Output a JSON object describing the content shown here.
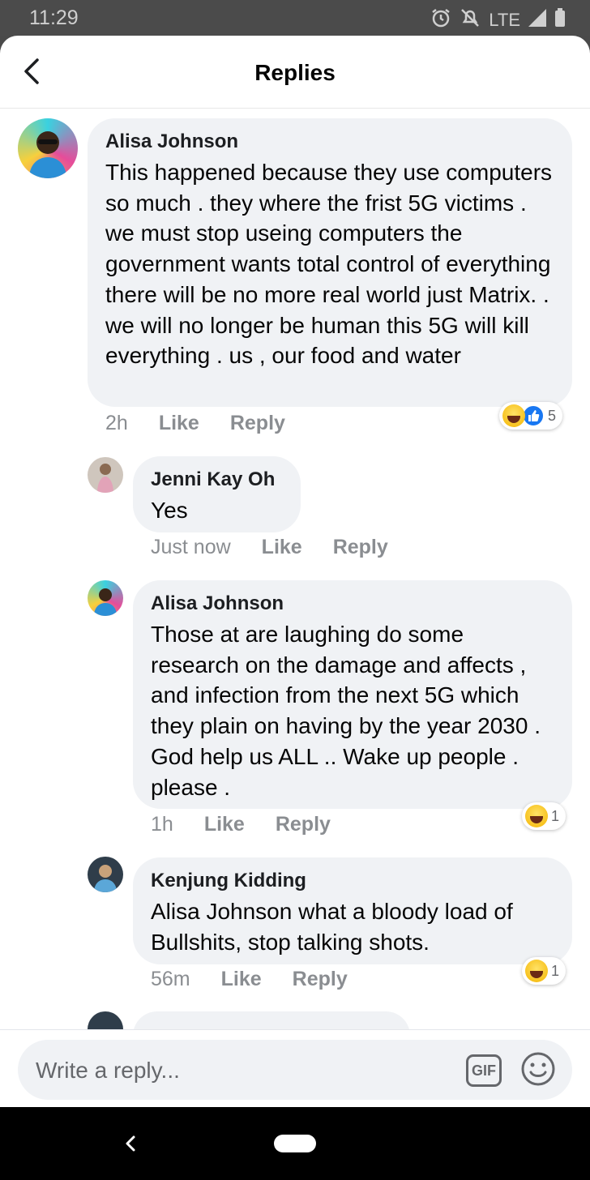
{
  "status_bar": {
    "time": "11:29",
    "network": "LTE",
    "icons": [
      "alarm-icon",
      "mute-icon",
      "signal-icon",
      "battery-icon"
    ]
  },
  "header": {
    "title": "Replies",
    "back_icon": "chevron-left-icon"
  },
  "comments": [
    {
      "author": "Alisa Johnson",
      "text": "This happened because they use computers so much . they where the frist 5G victims . we must stop useing computers the government wants total control of everything there will be no more real world just  Matrix. . we will no longer be human this 5G will kill everything . us , our food and water",
      "time": "2h",
      "like_label": "Like",
      "reply_label": "Reply",
      "reactions": [
        "haha",
        "like"
      ],
      "reaction_count": "5"
    },
    {
      "author": "Jenni Kay Oh",
      "text": "Yes",
      "time": "Just now",
      "like_label": "Like",
      "reply_label": "Reply"
    },
    {
      "author": "Alisa Johnson",
      "text": "Those at are laughing do some research on the damage and affects , and infection from the next 5G which they plain on having by the year 2030 . God help us ALL .. Wake up people . please .",
      "time": "1h",
      "like_label": "Like",
      "reply_label": "Reply",
      "reactions": [
        "haha"
      ],
      "reaction_count": "1"
    },
    {
      "author": "Kenjung Kidding",
      "text": "Alisa Johnson what a bloody load of Bullshits, stop talking shots.",
      "time": "56m",
      "like_label": "Like",
      "reply_label": "Reply",
      "reactions": [
        "haha"
      ],
      "reaction_count": "1"
    }
  ],
  "reply_bar": {
    "placeholder": "Write a reply...",
    "gif_label": "GIF",
    "emoji_icon": "smiley-icon"
  },
  "colors": {
    "bubble": "#f0f2f5",
    "meta_text": "#8a8d91",
    "like_blue": "#1877f2"
  }
}
